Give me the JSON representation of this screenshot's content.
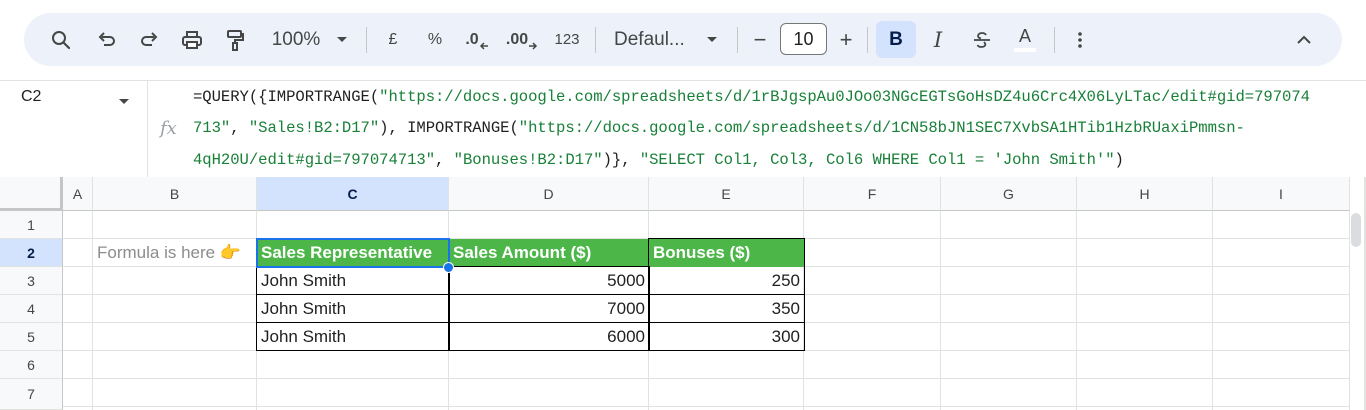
{
  "toolbar": {
    "zoom": "100%",
    "currency": "£",
    "percent": "%",
    "decrease_decimal": ".0",
    "increase_decimal": ".00",
    "number_format": "123",
    "font": "Defaul...",
    "font_size": "10",
    "minus": "−",
    "plus": "+",
    "bold": "B",
    "italic": "I",
    "text_color": "A",
    "icons": [
      "search-icon",
      "undo-icon",
      "redo-icon",
      "print-icon",
      "paint-format-icon",
      "chevron-down-icon",
      "strikethrough-icon",
      "more-vert-icon",
      "chevron-up-icon"
    ]
  },
  "formula_bar": {
    "cell_ref": "C2",
    "fx": "fx",
    "line1_prefix": "=QUERY({IMPORTRANGE(",
    "line1_str": "\"https://docs.google.com/spreadsheets/d/1rBJgspAu0JOo03NGcEGTsGoHsDZ4u6Crc4X06LyLTac/edit#gid=797074",
    "line2_str1": "713\"",
    "line2_sep1": ", ",
    "line2_str2": "\"Sales!B2:D17\"",
    "line2_mid": "), IMPORTRANGE(",
    "line2_str3": "\"https://docs.google.com/spreadsheets/d/1CN58bJN1SEC7XvbSA1HTib1HzbRUaxiPmmsn-",
    "line3_str1": "4qH20U/edit#gid=797074713\"",
    "line3_sep1": ", ",
    "line3_str2": "\"Bonuses!B2:D17\"",
    "line3_mid": ")}, ",
    "line3_str3": "\"SELECT Col1, Col3, Col6 WHERE Col1 = 'John Smith'\"",
    "line3_end": ")"
  },
  "grid": {
    "columns": [
      "A",
      "B",
      "C",
      "D",
      "E",
      "F",
      "G",
      "H",
      "I"
    ],
    "rows": [
      "1",
      "2",
      "3",
      "4",
      "5",
      "6",
      "7"
    ],
    "active_cell": "C2",
    "note": "Formula is here 👉",
    "headers": [
      "Sales Representative",
      "Sales Amount ($)",
      "Bonuses ($)"
    ],
    "records": [
      {
        "rep": "John Smith",
        "sales": "5000",
        "bonus": "250"
      },
      {
        "rep": "John Smith",
        "sales": "7000",
        "bonus": "350"
      },
      {
        "rep": "John Smith",
        "sales": "6000",
        "bonus": "300"
      }
    ],
    "colors": {
      "header_fill": "#4cb648",
      "selection": "#1a73e8",
      "active_header": "#d3e3fd"
    }
  }
}
